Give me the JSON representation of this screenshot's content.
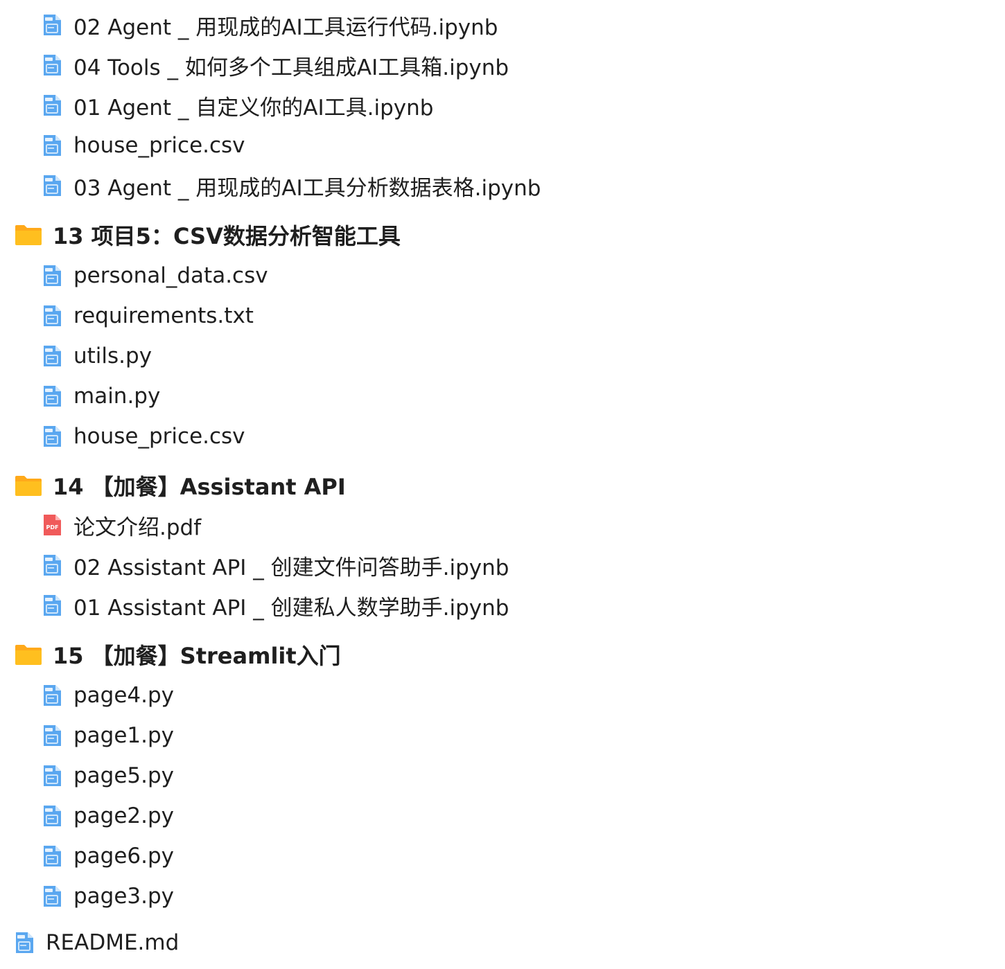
{
  "colors": {
    "file_icon_fill": "#5aa7f0",
    "file_icon_light": "#cfe6fb",
    "pdf_icon_fill": "#f05a5a",
    "folder_fill": "#ffbf1f",
    "folder_tab": "#ffa91a"
  },
  "rows": [
    {
      "kind": "file",
      "icon": "file-icon",
      "name": "02 Agent _ 用现成的AI工具运行代码.ipynb"
    },
    {
      "kind": "file",
      "icon": "file-icon",
      "name": "04 Tools _ 如何多个工具组成AI工具箱.ipynb"
    },
    {
      "kind": "file",
      "icon": "file-icon",
      "name": "01 Agent _ 自定义你的AI工具.ipynb"
    },
    {
      "kind": "file",
      "icon": "file-icon",
      "name": "house_price.csv"
    },
    {
      "kind": "file",
      "icon": "file-icon",
      "name": "03 Agent _ 用现成的AI工具分析数据表格.ipynb"
    },
    {
      "kind": "folder",
      "icon": "folder-icon",
      "name": "13 项目5：CSV数据分析智能工具"
    },
    {
      "kind": "file",
      "icon": "file-icon",
      "name": "personal_data.csv"
    },
    {
      "kind": "file",
      "icon": "file-icon",
      "name": "requirements.txt"
    },
    {
      "kind": "file",
      "icon": "file-icon",
      "name": "utils.py"
    },
    {
      "kind": "file",
      "icon": "file-icon",
      "name": "main.py"
    },
    {
      "kind": "file",
      "icon": "file-icon",
      "name": "house_price.csv"
    },
    {
      "kind": "folder",
      "icon": "folder-icon",
      "name": "14 【加餐】Assistant API"
    },
    {
      "kind": "file",
      "icon": "pdf-icon",
      "name": "论文介绍.pdf",
      "badge": "PDF"
    },
    {
      "kind": "file",
      "icon": "file-icon",
      "name": "02 Assistant API _ 创建文件问答助手.ipynb"
    },
    {
      "kind": "file",
      "icon": "file-icon",
      "name": "01 Assistant API _ 创建私人数学助手.ipynb"
    },
    {
      "kind": "folder",
      "icon": "folder-icon",
      "name": "15 【加餐】Streamlit入门"
    },
    {
      "kind": "file",
      "icon": "file-icon",
      "name": "page4.py"
    },
    {
      "kind": "file",
      "icon": "file-icon",
      "name": "page1.py"
    },
    {
      "kind": "file",
      "icon": "file-icon",
      "name": "page5.py"
    },
    {
      "kind": "file",
      "icon": "file-icon",
      "name": "page2.py"
    },
    {
      "kind": "file",
      "icon": "file-icon",
      "name": "page6.py"
    },
    {
      "kind": "file",
      "icon": "file-icon",
      "name": "page3.py"
    },
    {
      "kind": "root-file",
      "icon": "file-icon",
      "name": "README.md"
    }
  ]
}
